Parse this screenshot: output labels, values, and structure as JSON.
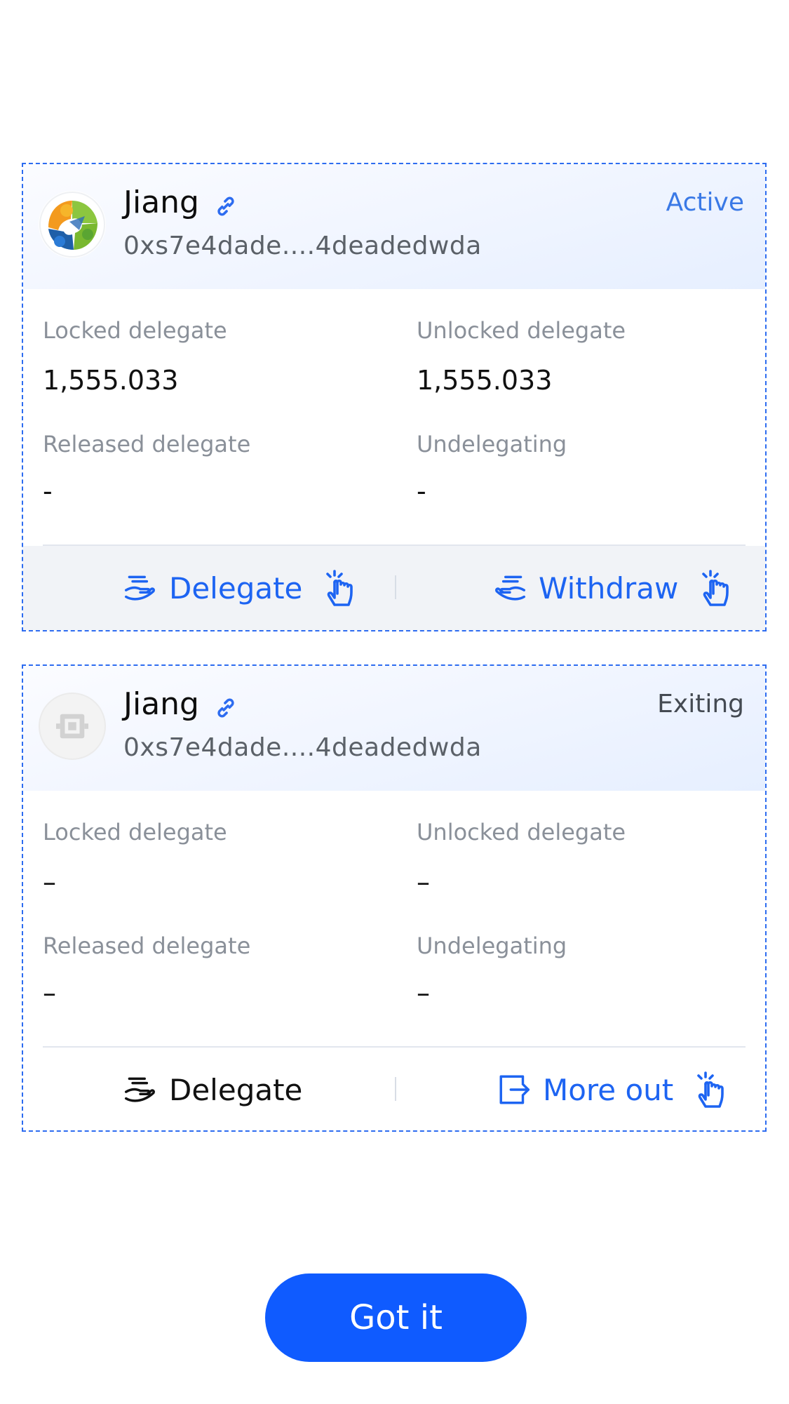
{
  "cards": [
    {
      "avatar": "validator-logo",
      "name": "Jiang",
      "link_icon": "link-icon",
      "address": "0xs7e4dade....4deadedwda",
      "status": "Active",
      "stats": {
        "locked_label": "Locked delegate",
        "locked_value": "1,555.033",
        "unlocked_label": "Unlocked delegate",
        "unlocked_value": "1,555.033",
        "released_label": "Released delegate",
        "released_value": "-",
        "undelegating_label": "Undelegating",
        "undelegating_value": "-"
      },
      "actions": {
        "left_label": "Delegate",
        "left_icon": "delegate-hand-icon",
        "right_label": "Withdraw",
        "right_icon": "withdraw-hand-icon",
        "pointer_icon": "tap-hand-icon"
      }
    },
    {
      "avatar": "placeholder-avatar",
      "name": "Jiang",
      "link_icon": "link-icon",
      "address": "0xs7e4dade....4deadedwda",
      "status": "Exiting",
      "stats": {
        "locked_label": "Locked delegate",
        "locked_value": "–",
        "unlocked_label": "Unlocked delegate",
        "unlocked_value": "–",
        "released_label": "Released delegate",
        "released_value": "–",
        "undelegating_label": "Undelegating",
        "undelegating_value": "–"
      },
      "actions": {
        "left_label": "Delegate",
        "left_icon": "delegate-hand-icon",
        "right_label": "More out",
        "right_icon": "exit-icon",
        "pointer_icon": "tap-hand-icon"
      }
    }
  ],
  "colors": {
    "accent": "#1d64f2",
    "button": "#0f5bff",
    "dashed_border": "#2d6cf0",
    "active_status": "#3a79e6"
  },
  "got_it_button": "Got it"
}
